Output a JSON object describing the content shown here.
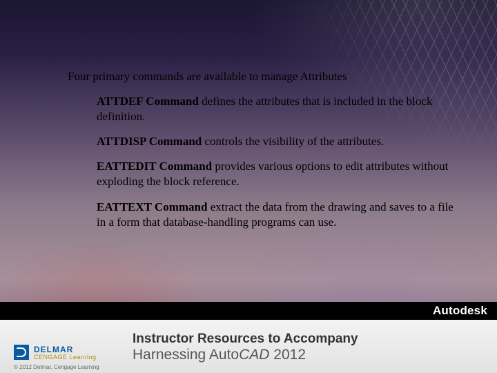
{
  "content": {
    "intro": "Four primary commands are available to manage Attributes",
    "items": [
      {
        "cmd": "ATTDEF Command",
        "desc": " defines the attributes that is included in the block definition."
      },
      {
        "cmd": "ATTDISP Command",
        "desc": " controls the visibility of the attributes."
      },
      {
        "cmd": "EATTEDIT Command",
        "desc": " provides various options to edit attributes without exploding the block reference."
      },
      {
        "cmd": "EATTEXT Command",
        "desc": " extract the data from the drawing and saves to a file in a form that database-handling programs can use."
      }
    ]
  },
  "bar": {
    "autodesk": "Autodesk"
  },
  "footer": {
    "brand1": "DELMAR",
    "brand2": "CENGAGE Learning",
    "copyright": "© 2012 Delmar, Cengage Learning",
    "line1": "Instructor Resources to Accompany",
    "line2a": "Harnessing Auto",
    "line2b": "CAD",
    "line2c": " 2012"
  }
}
